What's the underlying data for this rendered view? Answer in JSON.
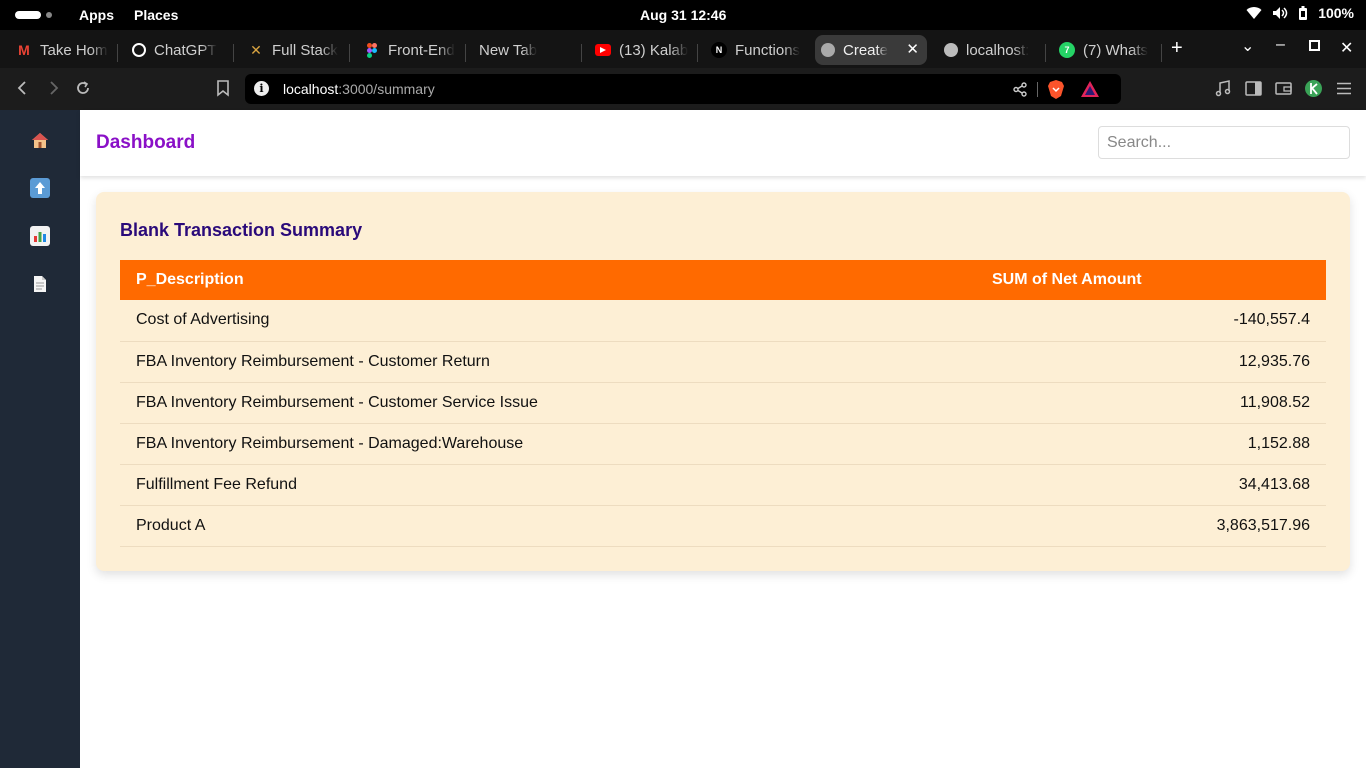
{
  "system_bar": {
    "apps": "Apps",
    "places": "Places",
    "clock": "Aug 31  12:46",
    "battery": "100%"
  },
  "browser": {
    "tabs": [
      {
        "label": "Take Hom",
        "icon": "gmail-icon",
        "color": "#ea4335"
      },
      {
        "label": "ChatGPT",
        "icon": "chatgpt-icon",
        "color": "#ffffff"
      },
      {
        "label": "Full Stack",
        "icon": "tools-icon",
        "color": "#d9a441"
      },
      {
        "label": "Front-End",
        "icon": "figma-icon",
        "color": "#a259ff"
      },
      {
        "label": "New Tab",
        "icon": "",
        "color": ""
      },
      {
        "label": "(13) Kalab",
        "icon": "youtube-icon",
        "color": "#ff0000"
      },
      {
        "label": "Functions",
        "icon": "notion-icon",
        "color": "#000000"
      },
      {
        "label": "Create",
        "icon": "globe-icon",
        "color": "#cccccc",
        "active": true
      },
      {
        "label": "localhost:",
        "icon": "globe-icon",
        "color": "#cccccc"
      },
      {
        "label": "(7) Whats",
        "icon": "whatsapp-icon",
        "color": "#25d366"
      }
    ],
    "url_host": "localhost",
    "url_path": ":3000/summary"
  },
  "app": {
    "title": "Dashboard",
    "search_placeholder": "Search...",
    "sidebar_icons": [
      "home-icon",
      "upload-icon",
      "chart-icon",
      "document-icon"
    ]
  },
  "summary": {
    "title": "Blank Transaction Summary",
    "columns": [
      "P_Description",
      "SUM of Net Amount"
    ],
    "rows": [
      {
        "description": "Cost of Advertising",
        "amount": "-140,557.4"
      },
      {
        "description": "FBA Inventory Reimbursement - Customer Return",
        "amount": "12,935.76"
      },
      {
        "description": "FBA Inventory Reimbursement - Customer Service Issue",
        "amount": "11,908.52"
      },
      {
        "description": "FBA Inventory Reimbursement - Damaged:Warehouse",
        "amount": "1,152.88"
      },
      {
        "description": "Fulfillment Fee Refund",
        "amount": "34,413.68"
      },
      {
        "description": "Product A",
        "amount": "3,863,517.96"
      }
    ]
  }
}
